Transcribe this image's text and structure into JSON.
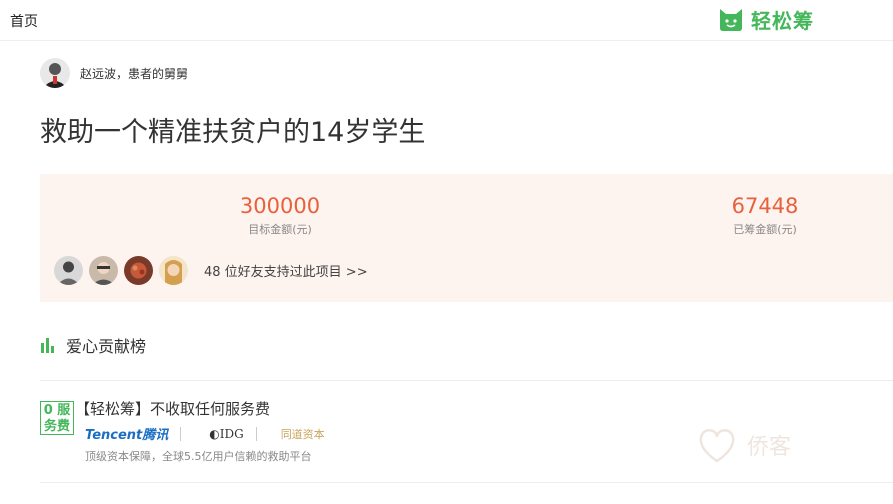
{
  "header": {
    "home_label": "首页",
    "brand_name": "轻松筹",
    "brand_color": "#43b75a"
  },
  "author": {
    "name_line": "赵远波，患者的舅舅"
  },
  "project": {
    "title": "救助一个精准扶贫户的14岁学生"
  },
  "stats": {
    "target_amount": "300000",
    "target_label": "目标金额(元)",
    "raised_amount": "67448",
    "raised_label": "已筹金额(元)",
    "accent_color": "#e8603c"
  },
  "friends": {
    "text": "48 位好友支持过此项目 >>"
  },
  "ranking": {
    "label": "爱心贡献榜"
  },
  "promo": {
    "badge_line1": "0 服",
    "badge_line2": "务费",
    "title": "【轻松筹】不收取任何服务费",
    "logo_tencent": "Tencent腾讯",
    "logo_idg": "◐IDG",
    "logo_fund": "同道资本",
    "subtitle": "顶级资本保障，全球5.5亿用户信赖的救助平台"
  },
  "watermark": {
    "text": "侨客"
  }
}
